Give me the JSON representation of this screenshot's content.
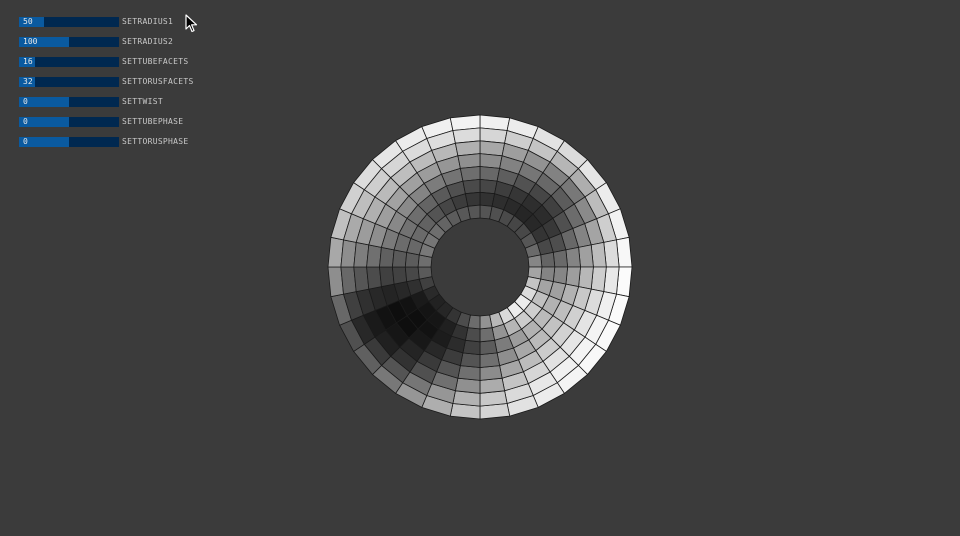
{
  "controls": [
    {
      "label": "SETRADIUS1",
      "value": "50",
      "fraction": 0.25
    },
    {
      "label": "SETRADIUS2",
      "value": "100",
      "fraction": 0.5
    },
    {
      "label": "SETTUBEFACETS",
      "value": "16",
      "fraction": 0.16
    },
    {
      "label": "SETTORUSFACETS",
      "value": "32",
      "fraction": 0.16
    },
    {
      "label": "SETTWIST",
      "value": "0",
      "fraction": 0.5
    },
    {
      "label": "SETTUBEPHASE",
      "value": "0",
      "fraction": 0.5
    },
    {
      "label": "SETTORUSPHASE",
      "value": "0",
      "fraction": 0.5
    }
  ],
  "colors": {
    "background": "#3b3b3b",
    "track": "#002850",
    "fill": "#0a5aa0"
  },
  "icons": {
    "cursor": "mouse-pointer-icon"
  }
}
